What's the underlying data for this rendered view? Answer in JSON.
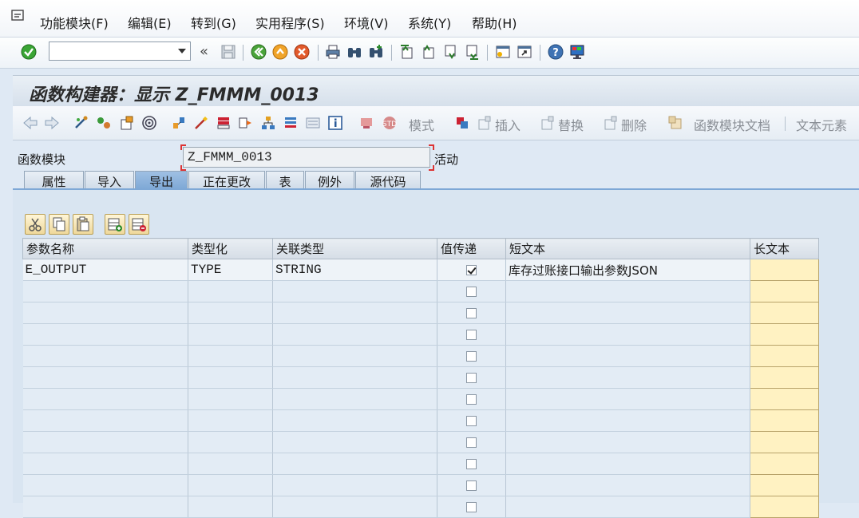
{
  "menubar": {
    "items": [
      {
        "label": "功能模块(F)"
      },
      {
        "label": "编辑(E)"
      },
      {
        "label": "转到(G)"
      },
      {
        "label": "实用程序(S)"
      },
      {
        "label": "环境(V)"
      },
      {
        "label": "系统(Y)"
      },
      {
        "label": "帮助(H)"
      }
    ]
  },
  "toolbar1": {
    "command_value": "",
    "history_glyph": "«"
  },
  "title": "函数构建器：显示 Z_FMMM_0013",
  "toolbar2": {
    "mode_label": "模式",
    "insert_label": "插入",
    "replace_label": "替换",
    "delete_label": "删除",
    "fm_doc_label": "函数模块文档",
    "text_elements_label": "文本元素"
  },
  "header": {
    "fm_label": "函数模块",
    "fm_value": "Z_FMMM_0013",
    "status": "活动"
  },
  "tabs": [
    {
      "label": "属性"
    },
    {
      "label": "导入"
    },
    {
      "label": "导出",
      "active": true
    },
    {
      "label": "正在更改"
    },
    {
      "label": "表"
    },
    {
      "label": "例外"
    },
    {
      "label": "源代码"
    }
  ],
  "table": {
    "columns": [
      "参数名称",
      "类型化",
      "关联类型",
      "值传递",
      "短文本",
      "长文本"
    ],
    "rows": [
      {
        "name": "E_OUTPUT",
        "typing": "TYPE",
        "assoc": "STRING",
        "by_value": true,
        "short_text": "库存过账接口输出参数JSON"
      }
    ],
    "empty_rows": 11
  },
  "colors": {
    "accent": "#7ea8d6",
    "background": "#dfe9f4",
    "long_text_cell": "#fff2c2"
  }
}
